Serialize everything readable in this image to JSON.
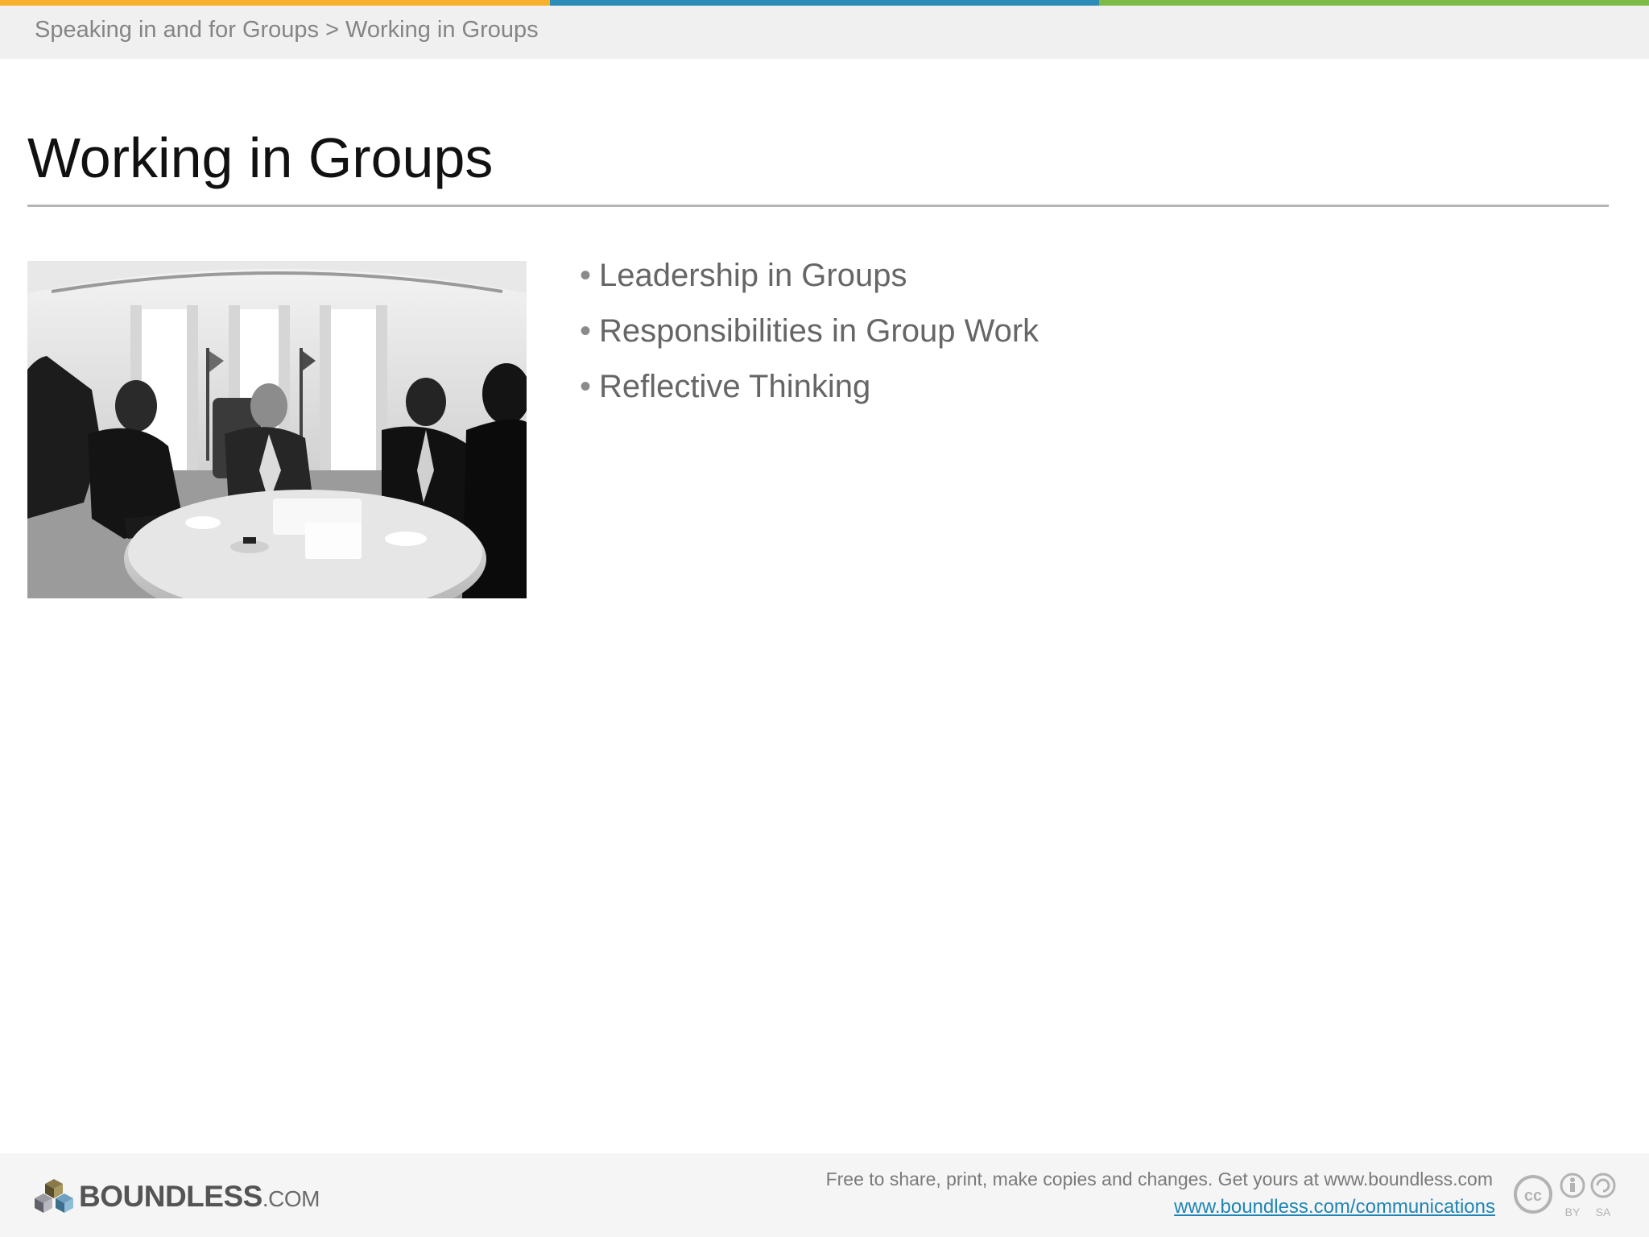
{
  "colors": {
    "stripe_orange": "#f8b12c",
    "stripe_blue": "#2a8cb7",
    "stripe_green": "#7dbb46",
    "header_bg": "#f0f0f0",
    "footer_bg": "#f5f5f5",
    "link": "#1f84b5"
  },
  "breadcrumb": {
    "parent": "Speaking in and for Groups",
    "separator": ">",
    "current": "Working in Groups"
  },
  "slide": {
    "title": "Working in Groups",
    "bullet_glyph": "•",
    "bullets": [
      "Leadership in Groups",
      "Responsibilities in Group Work",
      "Reflective Thinking"
    ]
  },
  "footer": {
    "logo_main": "BOUNDLESS",
    "logo_suffix": ".COM",
    "note": "Free to share, print, make copies and changes. Get yours at www.boundless.com",
    "link": "www.boundless.com/communications",
    "license_icon": "cc-by-sa-icon",
    "license_labels": [
      "BY",
      "SA"
    ]
  }
}
